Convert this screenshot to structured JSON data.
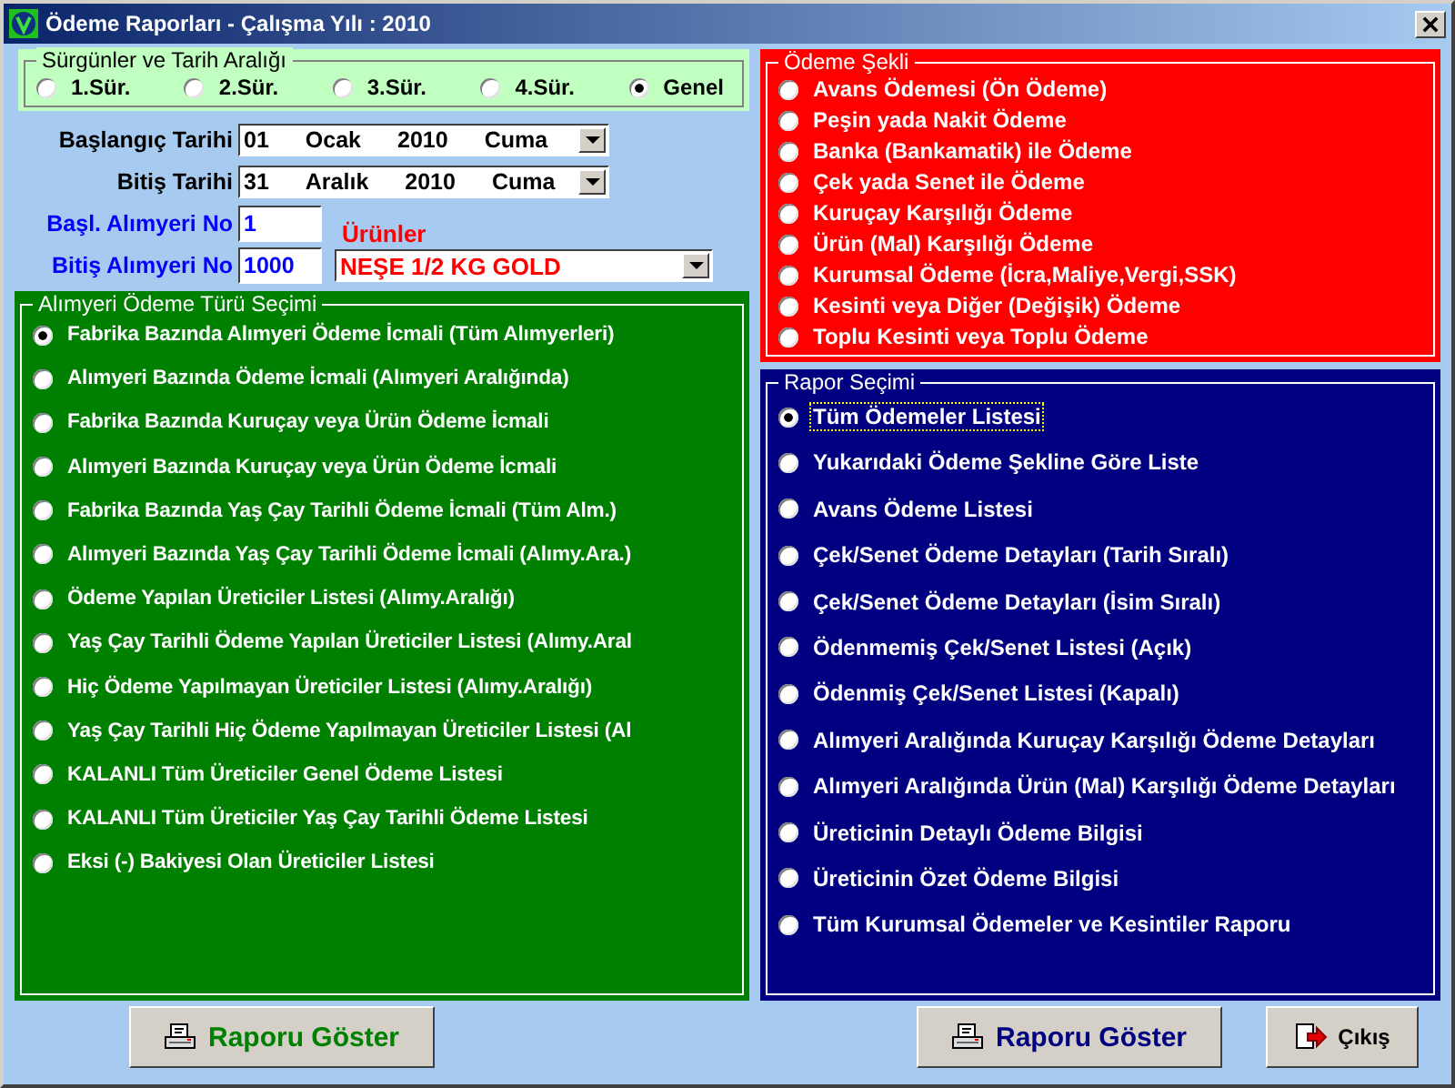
{
  "window": {
    "title": "Ödeme Raporları - Çalışma Yılı : 2010"
  },
  "period": {
    "title": "Sürgünler ve Tarih Aralığı",
    "options": [
      {
        "label": "1.Sür.",
        "selected": false
      },
      {
        "label": "2.Sür.",
        "selected": false
      },
      {
        "label": "3.Sür.",
        "selected": false
      },
      {
        "label": "4.Sür.",
        "selected": false
      },
      {
        "label": "Genel",
        "selected": true
      }
    ]
  },
  "date_fields": [
    {
      "label": "Başlangıç Tarihi",
      "value_parts": [
        "01",
        "Ocak",
        "2010",
        "Cuma"
      ]
    },
    {
      "label": "Bitiş Tarihi",
      "value_parts": [
        "31",
        "Aralık",
        "2010",
        "Cuma"
      ]
    }
  ],
  "purchase_point": {
    "start_label": "Başl. Alımyeri No",
    "start_value": "1",
    "end_label": "Bitiş Alımyeri No",
    "end_value": "1000"
  },
  "products": {
    "label": "Ürünler",
    "value": "NEŞE 1/2 KG GOLD"
  },
  "payment_type_selection": {
    "title": "Alımyeri Ödeme Türü Seçimi",
    "options": [
      {
        "label": "Fabrika Bazında Alımyeri Ödeme İcmali (Tüm Alımyerleri)",
        "selected": true
      },
      {
        "label": "Alımyeri Bazında Ödeme İcmali (Alımyeri Aralığında)",
        "selected": false
      },
      {
        "label": "Fabrika Bazında Kuruçay veya Ürün Ödeme İcmali",
        "selected": false
      },
      {
        "label": "Alımyeri Bazında Kuruçay veya Ürün Ödeme İcmali",
        "selected": false
      },
      {
        "label": "Fabrika Bazında Yaş Çay Tarihli Ödeme İcmali (Tüm Alm.)",
        "selected": false
      },
      {
        "label": "Alımyeri Bazında Yaş Çay Tarihli Ödeme İcmali (Alımy.Ara.)",
        "selected": false
      },
      {
        "label": "Ödeme Yapılan Üreticiler Listesi (Alımy.Aralığı)",
        "selected": false
      },
      {
        "label": "Yaş Çay Tarihli Ödeme Yapılan Üreticiler Listesi (Alımy.Aral",
        "selected": false
      },
      {
        "label": "Hiç Ödeme Yapılmayan Üreticiler Listesi (Alımy.Aralığı)",
        "selected": false
      },
      {
        "label": "Yaş Çay Tarihli Hiç Ödeme Yapılmayan Üreticiler Listesi (Al",
        "selected": false
      },
      {
        "label": "KALANLI Tüm Üreticiler Genel Ödeme Listesi",
        "selected": false
      },
      {
        "label": "KALANLI Tüm Üreticiler Yaş Çay Tarihli Ödeme Listesi",
        "selected": false
      },
      {
        "label": "Eksi (-) Bakiyesi Olan Üreticiler Listesi",
        "selected": false
      }
    ],
    "button": "Raporu Göster"
  },
  "payment_method": {
    "title": "Ödeme Şekli",
    "options": [
      {
        "label": "Avans Ödemesi (Ön Ödeme)",
        "selected": false
      },
      {
        "label": "Peşin yada Nakit Ödeme",
        "selected": false
      },
      {
        "label": "Banka (Bankamatik) ile Ödeme",
        "selected": false
      },
      {
        "label": "Çek yada Senet ile Ödeme",
        "selected": false
      },
      {
        "label": "Kuruçay Karşılığı Ödeme",
        "selected": false
      },
      {
        "label": "Ürün (Mal) Karşılığı Ödeme",
        "selected": false
      },
      {
        "label": "Kurumsal Ödeme (İcra,Maliye,Vergi,SSK)",
        "selected": false
      },
      {
        "label": "Kesinti veya Diğer (Değişik) Ödeme",
        "selected": false
      },
      {
        "label": "Toplu Kesinti veya Toplu Ödeme",
        "selected": false
      }
    ]
  },
  "report_selection": {
    "title": "Rapor Seçimi",
    "options": [
      {
        "label": "Tüm Ödemeler Listesi",
        "selected": true,
        "focused": true
      },
      {
        "label": "Yukarıdaki Ödeme Şekline Göre Liste",
        "selected": false,
        "focused": false
      },
      {
        "label": "Avans Ödeme Listesi",
        "selected": false,
        "focused": false
      },
      {
        "label": "Çek/Senet Ödeme Detayları (Tarih Sıralı)",
        "selected": false,
        "focused": false
      },
      {
        "label": "Çek/Senet Ödeme Detayları (İsim Sıralı)",
        "selected": false,
        "focused": false
      },
      {
        "label": "Ödenmemiş Çek/Senet Listesi (Açık)",
        "selected": false,
        "focused": false
      },
      {
        "label": "Ödenmiş Çek/Senet Listesi (Kapalı)",
        "selected": false,
        "focused": false
      },
      {
        "label": "Alımyeri Aralığında Kuruçay Karşılığı Ödeme Detayları",
        "selected": false,
        "focused": false
      },
      {
        "label": "Alımyeri Aralığında Ürün (Mal) Karşılığı Ödeme Detayları",
        "selected": false,
        "focused": false
      },
      {
        "label": "Üreticinin Detaylı Ödeme Bilgisi",
        "selected": false,
        "focused": false
      },
      {
        "label": "Üreticinin Özet Ödeme Bilgisi",
        "selected": false,
        "focused": false
      },
      {
        "label": "Tüm Kurumsal Ödemeler ve Kesintiler Raporu",
        "selected": false,
        "focused": false
      }
    ],
    "button": "Raporu Göster"
  },
  "exit_button": "Çıkış"
}
